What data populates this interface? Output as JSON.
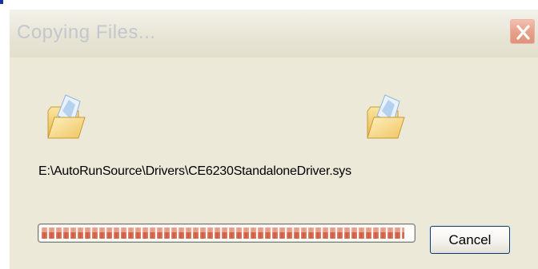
{
  "dialog": {
    "title": "Copying Files...",
    "close_icon": "close-icon",
    "source_icon": "folder-icon",
    "destination_icon": "folder-icon",
    "file_path": "E:\\AutoRunSource\\Drivers\\CE6230StandaloneDriver.sys",
    "progress_fraction": 0.98,
    "cancel_label": "Cancel"
  },
  "colors": {
    "dialog_background": "#ece9d8",
    "title_text": "#c4c7cc",
    "close_button": "#e39a84",
    "progress_chunk": "#d8664a"
  }
}
